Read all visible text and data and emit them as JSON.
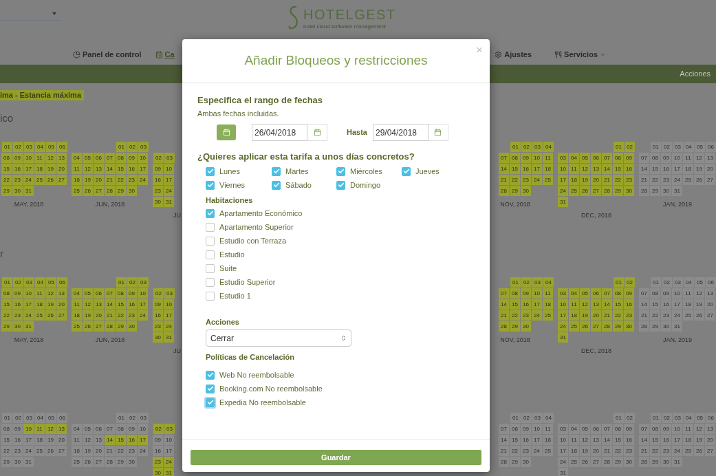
{
  "header": {
    "logo_title": "HOTELGEST",
    "logo_tagline": "hotel cloud software management"
  },
  "nav": [
    {
      "label": "Panel de control",
      "kind": "pie",
      "selected": false,
      "dropdown": false
    },
    {
      "label": "Ca",
      "kind": "calendar",
      "selected": true,
      "dropdown": false
    },
    {
      "label": "Ajustes",
      "kind": "gear",
      "selected": false,
      "dropdown": false
    },
    {
      "label": "Servicios",
      "kind": "utensils",
      "selected": false,
      "dropdown": true
    }
  ],
  "action_bar": {
    "label": "Acciones"
  },
  "legend": {
    "label": "ima - Estancia máxima"
  },
  "sections": [
    {
      "title": "ico",
      "months_left": [
        {
          "label": "MAY, 2018",
          "weeks": [
            {
              "days": [
                "01",
                "02",
                "03",
                "04",
                "05",
                "06"
              ],
              "marked": [
                true,
                true,
                true,
                true,
                true,
                true
              ]
            },
            {
              "days": [
                "08",
                "09",
                "10",
                "11",
                "12",
                "13"
              ],
              "marked": [
                true,
                true,
                true,
                true,
                true,
                true
              ]
            },
            {
              "days": [
                "15",
                "16",
                "17",
                "18",
                "19",
                "20"
              ],
              "marked": [
                true,
                true,
                true,
                true,
                true,
                true
              ]
            },
            {
              "days": [
                "22",
                "23",
                "24",
                "25",
                "26",
                "27"
              ],
              "marked": [
                true,
                true,
                true,
                true,
                true,
                true
              ]
            },
            {
              "days": [
                "29",
                "30",
                "31"
              ],
              "marked": [
                true,
                true,
                true
              ]
            }
          ]
        },
        {
          "label": "JUN, 2018",
          "weeks": [
            {
              "days": [
                "01",
                "02",
                "03"
              ],
              "marked": [
                true,
                true,
                true
              ]
            },
            {
              "days": [
                "04",
                "05",
                "06",
                "07",
                "08",
                "09",
                "10"
              ],
              "marked": [
                true,
                true,
                true,
                true,
                true,
                true,
                true
              ]
            },
            {
              "days": [
                "11",
                "12",
                "13",
                "14",
                "15",
                "16",
                "17"
              ],
              "marked": [
                true,
                true,
                true,
                true,
                true,
                true,
                true
              ]
            },
            {
              "days": [
                "18",
                "19",
                "20",
                "21",
                "22",
                "23",
                "24"
              ],
              "marked": [
                true,
                true,
                true,
                true,
                true,
                true,
                true
              ]
            },
            {
              "days": [
                "25",
                "26",
                "27",
                "28",
                "29",
                "30"
              ],
              "marked": [
                true,
                true,
                true,
                true,
                true,
                true
              ]
            }
          ]
        },
        {
          "label": "JU",
          "weeks": [
            {
              "days": [
                "02",
                "03"
              ],
              "marked": [
                true,
                true
              ]
            },
            {
              "days": [
                "09",
                "10"
              ],
              "marked": [
                true,
                true
              ]
            },
            {
              "days": [
                "16",
                "17"
              ],
              "marked": [
                true,
                true
              ]
            },
            {
              "days": [
                "23",
                "24"
              ],
              "marked": [
                true,
                true
              ]
            },
            {
              "days": [
                "30",
                "31"
              ],
              "marked": [
                true,
                true
              ]
            }
          ]
        }
      ],
      "months_right": [
        {
          "label": "NOV, 2018",
          "weeks": [
            {
              "days": [
                "01",
                "02",
                "03",
                "04"
              ],
              "marked": [
                true,
                true,
                true,
                true
              ]
            },
            {
              "days": [
                "07",
                "08",
                "09",
                "10",
                "11"
              ],
              "marked": [
                true,
                true,
                true,
                true,
                true
              ]
            },
            {
              "days": [
                "14",
                "15",
                "16",
                "17",
                "18"
              ],
              "marked": [
                true,
                true,
                true,
                true,
                true
              ]
            },
            {
              "days": [
                "21",
                "22",
                "23",
                "24",
                "25"
              ],
              "marked": [
                true,
                true,
                true,
                true,
                true
              ]
            },
            {
              "days": [
                "28",
                "29",
                "30"
              ],
              "marked": [
                true,
                true,
                true
              ]
            }
          ]
        },
        {
          "label": "DEC, 2018",
          "weeks": [
            {
              "days": [
                "01",
                "02"
              ],
              "marked": [
                true,
                true
              ]
            },
            {
              "days": [
                "03",
                "04",
                "05",
                "06",
                "07",
                "08",
                "09"
              ],
              "marked": [
                true,
                true,
                true,
                true,
                true,
                true,
                true
              ]
            },
            {
              "days": [
                "10",
                "11",
                "12",
                "13",
                "14",
                "15",
                "16"
              ],
              "marked": [
                true,
                true,
                true,
                true,
                true,
                true,
                true
              ]
            },
            {
              "days": [
                "17",
                "18",
                "19",
                "20",
                "21",
                "22",
                "23"
              ],
              "marked": [
                true,
                true,
                true,
                true,
                true,
                true,
                true
              ]
            },
            {
              "days": [
                "24",
                "25",
                "26",
                "27",
                "28",
                "29",
                "30"
              ],
              "marked": [
                true,
                true,
                true,
                true,
                true,
                true,
                true
              ]
            },
            {
              "days": [
                "31"
              ],
              "marked": [
                true
              ]
            }
          ]
        },
        {
          "label": "JAN, 2019",
          "weeks": [
            {
              "days": [
                "01",
                "02",
                "03",
                "04",
                "05",
                "06"
              ],
              "marked": [
                false,
                false,
                false,
                false,
                false,
                false
              ]
            },
            {
              "days": [
                "07",
                "08",
                "09",
                "10",
                "11",
                "12",
                "13"
              ],
              "marked": [
                false,
                false,
                false,
                false,
                false,
                false,
                false
              ]
            },
            {
              "days": [
                "14",
                "15",
                "16",
                "17",
                "18",
                "19",
                "20"
              ],
              "marked": [
                false,
                false,
                false,
                false,
                false,
                false,
                false
              ]
            },
            {
              "days": [
                "21",
                "22",
                "23",
                "24",
                "25",
                "26",
                "27"
              ],
              "marked": [
                false,
                false,
                false,
                false,
                false,
                false,
                false
              ]
            },
            {
              "days": [
                "28",
                "29",
                "30",
                "31"
              ],
              "marked": [
                false,
                false,
                false,
                false
              ]
            }
          ]
        }
      ]
    },
    {
      "title": "r",
      "months_left": [
        {
          "label": "MAY, 2018",
          "weeks": [
            {
              "days": [
                "01",
                "02",
                "03",
                "04",
                "05",
                "06"
              ],
              "marked": [
                true,
                true,
                true,
                true,
                true,
                true
              ]
            },
            {
              "days": [
                "08",
                "09",
                "10",
                "11",
                "12",
                "13"
              ],
              "marked": [
                true,
                true,
                true,
                true,
                true,
                true
              ]
            },
            {
              "days": [
                "15",
                "16",
                "17",
                "18",
                "19",
                "20"
              ],
              "marked": [
                true,
                true,
                true,
                true,
                true,
                true
              ]
            },
            {
              "days": [
                "22",
                "23",
                "24",
                "25",
                "26",
                "27"
              ],
              "marked": [
                true,
                true,
                true,
                true,
                true,
                true
              ]
            },
            {
              "days": [
                "29",
                "30",
                "31"
              ],
              "marked": [
                true,
                true,
                true
              ]
            }
          ]
        },
        {
          "label": "JUN, 2018",
          "weeks": [
            {
              "days": [
                "01",
                "02",
                "03"
              ],
              "marked": [
                true,
                true,
                true
              ]
            },
            {
              "days": [
                "04",
                "05",
                "06",
                "07",
                "08",
                "09",
                "10"
              ],
              "marked": [
                true,
                true,
                true,
                true,
                true,
                true,
                true
              ]
            },
            {
              "days": [
                "11",
                "12",
                "13",
                "14",
                "15",
                "16",
                "17"
              ],
              "marked": [
                true,
                true,
                true,
                true,
                true,
                true,
                true
              ]
            },
            {
              "days": [
                "18",
                "19",
                "20",
                "21",
                "22",
                "23",
                "24"
              ],
              "marked": [
                true,
                true,
                true,
                true,
                true,
                true,
                true
              ]
            },
            {
              "days": [
                "25",
                "26",
                "27",
                "28",
                "29",
                "30"
              ],
              "marked": [
                true,
                true,
                true,
                true,
                true,
                true
              ]
            }
          ]
        },
        {
          "label": "JU",
          "weeks": [
            {
              "days": [
                "02",
                "03"
              ],
              "marked": [
                true,
                true
              ]
            },
            {
              "days": [
                "09",
                "10"
              ],
              "marked": [
                true,
                true
              ]
            },
            {
              "days": [
                "16",
                "17"
              ],
              "marked": [
                true,
                true
              ]
            },
            {
              "days": [
                "23",
                "24"
              ],
              "marked": [
                true,
                true
              ]
            },
            {
              "days": [
                "30",
                "31"
              ],
              "marked": [
                true,
                true
              ]
            }
          ]
        }
      ],
      "months_right": [
        {
          "label": "NOV, 2018",
          "weeks": [
            {
              "days": [
                "01",
                "02",
                "03",
                "04"
              ],
              "marked": [
                true,
                true,
                true,
                true
              ]
            },
            {
              "days": [
                "07",
                "08",
                "09",
                "10",
                "11"
              ],
              "marked": [
                true,
                true,
                true,
                true,
                true
              ]
            },
            {
              "days": [
                "14",
                "15",
                "16",
                "17",
                "18"
              ],
              "marked": [
                true,
                true,
                true,
                true,
                true
              ]
            },
            {
              "days": [
                "21",
                "22",
                "23",
                "24",
                "25"
              ],
              "marked": [
                true,
                true,
                true,
                true,
                true
              ]
            },
            {
              "days": [
                "28",
                "29",
                "30"
              ],
              "marked": [
                true,
                true,
                true
              ]
            }
          ]
        },
        {
          "label": "DEC, 2018",
          "weeks": [
            {
              "days": [
                "01",
                "02"
              ],
              "marked": [
                true,
                true
              ]
            },
            {
              "days": [
                "03",
                "04",
                "05",
                "06",
                "07",
                "08",
                "09"
              ],
              "marked": [
                true,
                true,
                true,
                true,
                true,
                true,
                true
              ]
            },
            {
              "days": [
                "10",
                "11",
                "12",
                "13",
                "14",
                "15",
                "16"
              ],
              "marked": [
                true,
                true,
                true,
                true,
                true,
                true,
                true
              ]
            },
            {
              "days": [
                "17",
                "18",
                "19",
                "20",
                "21",
                "22",
                "23"
              ],
              "marked": [
                true,
                true,
                true,
                true,
                true,
                true,
                true
              ]
            },
            {
              "days": [
                "24",
                "25",
                "26",
                "27",
                "28",
                "29",
                "30"
              ],
              "marked": [
                true,
                true,
                true,
                true,
                true,
                true,
                true
              ]
            },
            {
              "days": [
                "31"
              ],
              "marked": [
                true
              ]
            }
          ]
        },
        {
          "label": "JAN, 2019",
          "weeks": [
            {
              "days": [
                "01",
                "02",
                "03",
                "04",
                "05",
                "06"
              ],
              "marked": [
                false,
                false,
                false,
                false,
                false,
                false
              ]
            },
            {
              "days": [
                "07",
                "08",
                "09",
                "10",
                "11",
                "12",
                "13"
              ],
              "marked": [
                false,
                false,
                false,
                false,
                false,
                false,
                false
              ]
            },
            {
              "days": [
                "14",
                "15",
                "16",
                "17",
                "18",
                "19",
                "20"
              ],
              "marked": [
                false,
                false,
                false,
                false,
                false,
                false,
                false
              ]
            },
            {
              "days": [
                "21",
                "22",
                "23",
                "24",
                "25",
                "26",
                "27"
              ],
              "marked": [
                false,
                false,
                false,
                false,
                false,
                false,
                false
              ]
            },
            {
              "days": [
                "28",
                "29",
                "30",
                "31"
              ],
              "marked": [
                false,
                false,
                false,
                false
              ]
            }
          ]
        }
      ]
    },
    {
      "months_left": [
        {
          "weeks": [
            {
              "days": [
                "01",
                "02",
                "03",
                "04",
                "05",
                "06"
              ],
              "marked": [
                false,
                false,
                false,
                false,
                false,
                false
              ]
            },
            {
              "days": [
                "08",
                "09",
                "10",
                "11",
                "12",
                "13"
              ],
              "marked": [
                false,
                false,
                true,
                true,
                true,
                true
              ]
            },
            {
              "days": [
                "15",
                "16",
                "17",
                "18",
                "19",
                "20"
              ],
              "marked": [
                false,
                false,
                false,
                false,
                false,
                false
              ]
            },
            {
              "days": [
                "22",
                "23",
                "24",
                "25",
                "26",
                "27"
              ],
              "marked": [
                false,
                false,
                false,
                false,
                false,
                false
              ]
            },
            {
              "days": [
                "29",
                "30",
                "31"
              ],
              "marked": [
                false,
                false,
                false
              ]
            }
          ]
        },
        {
          "weeks": [
            {
              "days": [
                "01",
                "02",
                "03"
              ],
              "marked": [
                false,
                false,
                false
              ]
            },
            {
              "days": [
                "04",
                "05",
                "06",
                "07",
                "08",
                "09",
                "10"
              ],
              "marked": [
                false,
                false,
                false,
                false,
                false,
                false,
                false
              ]
            },
            {
              "days": [
                "11",
                "12",
                "13",
                "14",
                "15",
                "16",
                "17"
              ],
              "marked": [
                false,
                false,
                false,
                true,
                true,
                true,
                true
              ]
            },
            {
              "days": [
                "18",
                "19",
                "20",
                "21",
                "22",
                "23",
                "24"
              ],
              "marked": [
                false,
                false,
                false,
                false,
                false,
                false,
                false
              ]
            },
            {
              "days": [
                "25",
                "26",
                "27",
                "28",
                "29",
                "30"
              ],
              "marked": [
                false,
                false,
                false,
                false,
                false,
                false
              ]
            }
          ]
        },
        {
          "weeks": [
            {
              "days": [
                "02",
                "03"
              ],
              "marked": [
                true,
                true
              ]
            },
            {
              "days": [
                "09",
                "10"
              ],
              "marked": [
                false,
                false
              ]
            },
            {
              "days": [
                "16",
                "17"
              ],
              "marked": [
                false,
                false
              ]
            },
            {
              "days": [
                "23",
                "24"
              ],
              "marked": [
                true,
                true
              ]
            },
            {
              "days": [
                "30",
                "31"
              ],
              "marked": [
                true,
                true
              ]
            }
          ]
        }
      ],
      "months_right": [
        {
          "weeks": [
            {
              "days": [
                "01",
                "02",
                "03",
                "04"
              ],
              "marked": [
                false,
                false,
                false,
                false
              ]
            },
            {
              "days": [
                "07",
                "08",
                "09",
                "10",
                "11"
              ],
              "marked": [
                false,
                false,
                false,
                false,
                false
              ]
            },
            {
              "days": [
                "14",
                "15",
                "16",
                "17",
                "18"
              ],
              "marked": [
                false,
                false,
                false,
                false,
                false
              ]
            },
            {
              "days": [
                "21",
                "22",
                "23",
                "24",
                "25"
              ],
              "marked": [
                false,
                false,
                false,
                false,
                false
              ]
            },
            {
              "days": [
                "28",
                "29",
                "30"
              ],
              "marked": [
                false,
                false,
                false
              ]
            }
          ]
        },
        {
          "weeks": [
            {
              "days": [
                "01",
                "02"
              ],
              "marked": [
                false,
                false
              ]
            },
            {
              "days": [
                "03",
                "04",
                "05",
                "06",
                "07",
                "08",
                "09"
              ],
              "marked": [
                false,
                false,
                false,
                false,
                false,
                false,
                false
              ]
            },
            {
              "days": [
                "10",
                "11",
                "12",
                "13",
                "14",
                "15",
                "16"
              ],
              "marked": [
                false,
                false,
                false,
                false,
                false,
                false,
                false
              ]
            },
            {
              "days": [
                "17",
                "18",
                "19",
                "20",
                "21",
                "22",
                "23"
              ],
              "marked": [
                false,
                false,
                false,
                false,
                false,
                false,
                false
              ]
            },
            {
              "days": [
                "24",
                "25",
                "26",
                "27",
                "28",
                "29",
                "30"
              ],
              "marked": [
                false,
                false,
                false,
                false,
                false,
                false,
                false
              ]
            },
            {
              "days": [
                "31"
              ],
              "marked": [
                false
              ]
            }
          ]
        },
        {
          "weeks": [
            {
              "days": [
                "01",
                "02",
                "03",
                "04",
                "05",
                "06"
              ],
              "marked": [
                false,
                false,
                false,
                false,
                false,
                false
              ]
            },
            {
              "days": [
                "07",
                "08",
                "09",
                "10",
                "11",
                "12",
                "13"
              ],
              "marked": [
                false,
                false,
                false,
                false,
                false,
                false,
                false
              ]
            },
            {
              "days": [
                "14",
                "15",
                "16",
                "17",
                "18",
                "19",
                "20"
              ],
              "marked": [
                false,
                false,
                false,
                false,
                false,
                false,
                false
              ]
            },
            {
              "days": [
                "21",
                "22",
                "23",
                "24",
                "25",
                "26",
                "27"
              ],
              "marked": [
                false,
                false,
                false,
                false,
                false,
                false,
                false
              ]
            },
            {
              "days": [
                "28",
                "29",
                "30",
                "31"
              ],
              "marked": [
                false,
                false,
                false,
                false
              ]
            }
          ]
        }
      ]
    }
  ],
  "modal": {
    "title": "Añadir Bloqueos y restricciones",
    "close": "×",
    "range_heading": "Especifica el rango de fechas",
    "range_note": "Ambas fechas incluidas.",
    "from_value": "26/04/2018",
    "to_label": "Hasta",
    "to_value": "29/04/2018",
    "days_heading": "¿Quieres aplicar esta tarifa a unos días concretos?",
    "days": [
      {
        "label": "Lunes",
        "checked": true
      },
      {
        "label": "Martes",
        "checked": true
      },
      {
        "label": "Miércoles",
        "checked": true
      },
      {
        "label": "Jueves",
        "checked": true
      },
      {
        "label": "Viernes",
        "checked": true
      },
      {
        "label": "Sábado",
        "checked": true
      },
      {
        "label": "Domingo",
        "checked": true
      }
    ],
    "rooms_heading": "Habitaciones",
    "rooms": [
      {
        "label": "Apartamento Económico",
        "checked": true
      },
      {
        "label": "Apartamento Superior",
        "checked": false
      },
      {
        "label": "Estudio con Terraza",
        "checked": false
      },
      {
        "label": "Estudio",
        "checked": false
      },
      {
        "label": "Suite",
        "checked": false
      },
      {
        "label": "Estudio Superior",
        "checked": false
      },
      {
        "label": "Estudio 1",
        "checked": false
      }
    ],
    "actions_heading": "Acciones",
    "action_value": "Cerrar",
    "policies_heading": "Políticas de Cancelación",
    "policies": [
      {
        "label": "Web No reembolsable",
        "checked": true,
        "focused": false
      },
      {
        "label": "Booking.com No reembolsable",
        "checked": true,
        "focused": false
      },
      {
        "label": "Expedia No reembolsable",
        "checked": true,
        "focused": true
      }
    ],
    "save": "Guardar"
  }
}
